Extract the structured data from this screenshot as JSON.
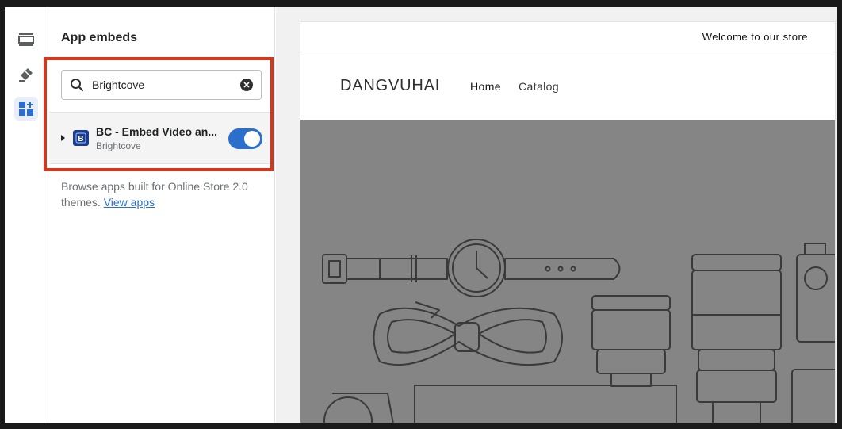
{
  "panel": {
    "title": "App embeds",
    "search": {
      "value": "Brightcove",
      "placeholder": "Search"
    },
    "app": {
      "name": "BC - Embed Video an...",
      "vendor": "Brightcove",
      "logo_letter": "B",
      "enabled": true
    },
    "browse_text": "Browse apps built for Online Store 2.0 themes.",
    "browse_link": "View apps"
  },
  "store": {
    "announcement": "Welcome to our store",
    "brand": "DANGVUHAI",
    "nav": [
      {
        "label": "Home"
      },
      {
        "label": "Catalog"
      }
    ]
  },
  "colors": {
    "accent": "#2c6ecb",
    "highlight": "#d9341c",
    "hero_bg": "#858585"
  }
}
